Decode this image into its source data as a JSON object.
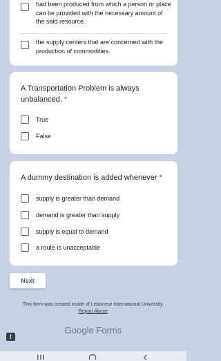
{
  "question1": {
    "options": [
      {
        "label": "had been produced from which a person or place can be provided with the necessary amount of the said resource."
      },
      {
        "label": "the supply centers that are concerned with the production of commodities."
      }
    ]
  },
  "question2": {
    "title": "A Transportation Problem is always unbalanced.",
    "required_marker": "*",
    "options": [
      {
        "label": "True"
      },
      {
        "label": "False"
      }
    ]
  },
  "question3": {
    "title": "A dummy destination is added whenever",
    "required_marker": "*",
    "options": [
      {
        "label": "supply is greater than demand"
      },
      {
        "label": "demand is greater than supply"
      },
      {
        "label": "supply is equal to demand"
      },
      {
        "label": "a route is unacceptable"
      }
    ]
  },
  "next_button": {
    "label": "Next"
  },
  "footer": {
    "created_note": "This form was created inside of Lebanese International University.",
    "report_link": "Report Abuse",
    "brand_google": "Google",
    "brand_forms": "Forms"
  },
  "icons": {
    "report": "exclamation-icon",
    "nav_recents": "recents-icon",
    "nav_home": "home-icon",
    "nav_back": "back-icon"
  },
  "colors": {
    "background": "#c6d2e4",
    "card": "#ffffff",
    "required": "#d93025",
    "accent": "#3f5e96"
  }
}
